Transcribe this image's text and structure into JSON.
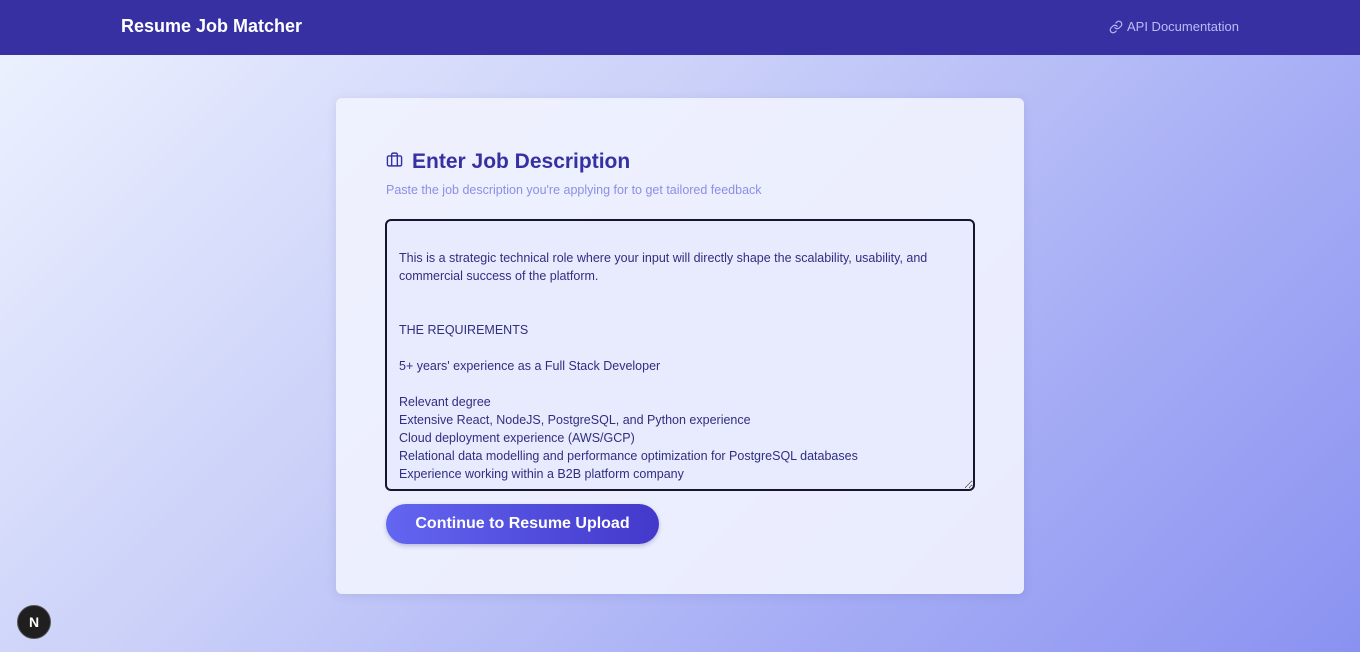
{
  "header": {
    "title": "Resume Job Matcher",
    "api_link_label": "API Documentation",
    "api_link_icon": "link-icon"
  },
  "card": {
    "icon": "briefcase-icon",
    "title": "Enter Job Description",
    "subtitle": "Paste the job description you're applying for to get tailored feedback",
    "textarea_value": "This is a strategic technical role where your input will directly shape the scalability, usability, and commercial success of the platform.\n\n\nTHE REQUIREMENTS\n\n5+ years' experience as a Full Stack Developer\n\nRelevant degree\nExtensive React, NodeJS, PostgreSQL, and Python experience\nCloud deployment experience (AWS/GCP)\nRelational data modelling and performance optimization for PostgreSQL databases\nExperience working within a B2B platform company",
    "continue_label": "Continue to Resume Upload"
  },
  "dev_badge": {
    "label": "N"
  },
  "colors": {
    "header_bg": "#3730a3",
    "accent": "#4338ca",
    "title_color": "#3730a3",
    "subtitle_color": "#8b8fe6"
  }
}
